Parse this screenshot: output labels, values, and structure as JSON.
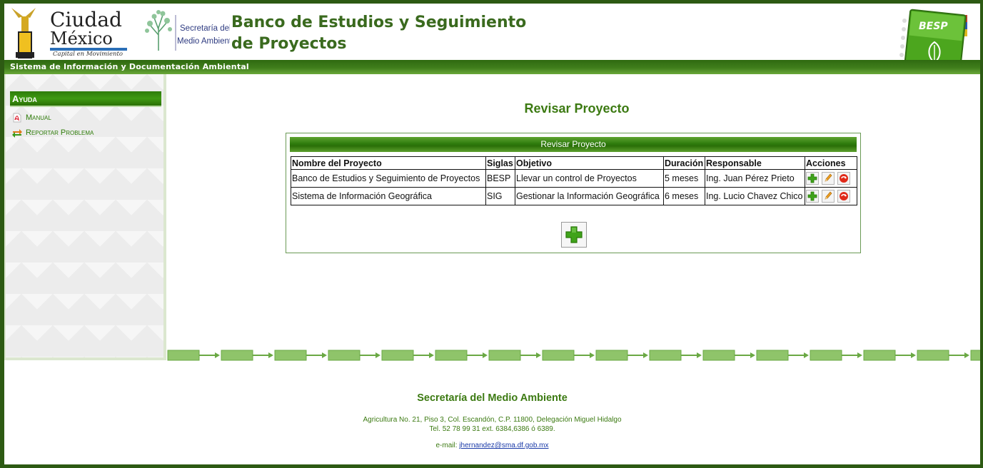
{
  "header": {
    "logo_cdmx": {
      "line1": "Ciudad",
      "line2": "México",
      "tagline": "Capital en Movimiento"
    },
    "logo_sma": {
      "line1": "Secretaría del",
      "line2": "Medio Ambiente"
    },
    "title": "Banco de Estudios y Seguimiento de Proyectos",
    "besp_badge": "BESP",
    "subtitle": "Sistema de Información y Documentación Ambiental"
  },
  "sidebar": {
    "heading": "Ayuda",
    "links": [
      {
        "label": "Manual",
        "icon": "pdf-icon"
      },
      {
        "label": "Reportar Problema",
        "icon": "report-arrows-icon"
      }
    ]
  },
  "main": {
    "page_title": "Revisar Proyecto",
    "panel_title": "Revisar Proyecto",
    "columns": [
      "Nombre del Proyecto",
      "Siglas",
      "Objetivo",
      "Duración",
      "Responsable",
      "Acciones"
    ],
    "rows": [
      {
        "nombre": "Banco de Estudios y Seguimiento de Proyectos",
        "siglas": "BESP",
        "objetivo": "Llevar un control de Proyectos",
        "duracion": "5 meses",
        "responsable": "Ing. Juan Pérez Prieto"
      },
      {
        "nombre": "Sistema de Información Geográfica",
        "siglas": "SIG",
        "objetivo": "Gestionar la Información Geográfica",
        "duracion": "6 meses",
        "responsable": "Ing. Lucio Chavez Chico"
      }
    ],
    "row_actions": [
      "add-icon",
      "edit-pencil-icon",
      "delete-icon"
    ]
  },
  "footer": {
    "title": "Secretaría del Medio Ambiente",
    "address": "Agricultura No. 21, Piso 3, Col. Escandón, C.P. 11800, Delegación Miguel Hidalgo",
    "phone": "Tel. 52 78 99 31 ext. 6384,6386 ó 6389.",
    "email_label": "e-mail:",
    "email": "jhernandez@sma.df.gob.mx"
  },
  "colors": {
    "brand_green": "#3c7a12",
    "frame_green": "#2d5a13",
    "link_blue": "#1a3aa8"
  }
}
